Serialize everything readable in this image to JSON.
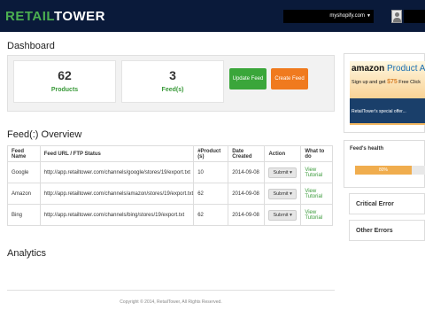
{
  "header": {
    "logo_part1": "RETAIL",
    "logo_part2": "TOWER",
    "store_label": "myshopify.com",
    "caret": "▼"
  },
  "dashboard": {
    "title": "Dashboard",
    "stats": [
      {
        "value": "62",
        "label": "Products"
      },
      {
        "value": "3",
        "label": "Feed(s)"
      }
    ],
    "update_button": "Update Feed",
    "create_button": "Create Feed"
  },
  "feed_overview": {
    "title": "Feed(:) Overview",
    "columns": [
      "Feed Name",
      "Feed URL / FTP Status",
      "#Product (s)",
      "Date Created",
      "Action",
      "What to do"
    ],
    "rows": [
      {
        "name": "Google",
        "url": "http://app.retailtower.com/channels/google/stores/19/export.txt",
        "products": "10",
        "date": "2014-09-08",
        "action": "Submit ▾",
        "todo": "View Tutorial"
      },
      {
        "name": "Amazon",
        "url": "http://app.retailtower.com/channels/amazon/stores/19/export.txt",
        "products": "62",
        "date": "2014-09-08",
        "action": "Submit ▾",
        "todo": "View Tutorial"
      },
      {
        "name": "Bing",
        "url": "http://app.retailtower.com/channels/bing/stores/19/export.txt",
        "products": "62",
        "date": "2014-09-08",
        "action": "Submit ▾",
        "todo": "View Tutorial"
      }
    ]
  },
  "analytics": {
    "title": "Analytics"
  },
  "footer": {
    "text": "Copyright © 2014, RetailTower, All Rights Reserved."
  },
  "ad": {
    "brand": "amazon",
    "product": "Product A",
    "signup": "Sign up and get",
    "amount": "$75",
    "signup_tail": "Free Click",
    "offer": "RetailTower's special offer..."
  },
  "health": {
    "title": "Feed's health",
    "progress_percent": 80,
    "progress_label": "80%"
  },
  "errors": {
    "critical": "Critical Error",
    "other": "Other Errors"
  }
}
